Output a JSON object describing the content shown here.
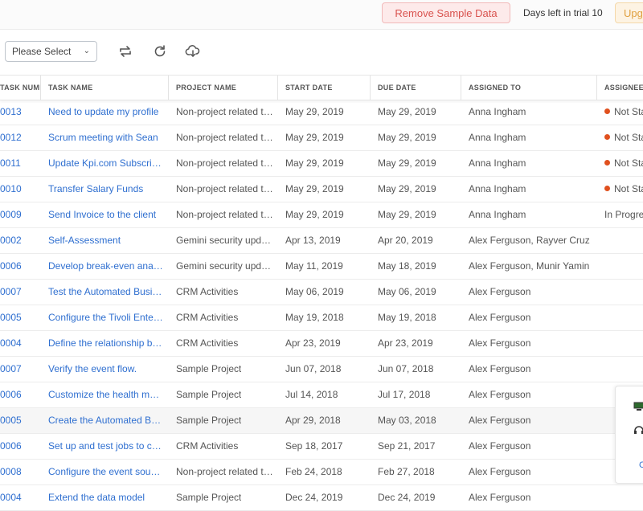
{
  "header": {
    "remove_sample_label": "Remove Sample Data",
    "trial_text": "Days left in trial 10",
    "upgrade_label": "Upgrade"
  },
  "toolbar": {
    "select_value": "Please Select",
    "icons": [
      "swap-icon",
      "refresh-icon",
      "cloud-download-icon"
    ]
  },
  "table": {
    "columns": [
      "TASK NUMBER",
      "TASK NAME",
      "PROJECT NAME",
      "START DATE",
      "DUE DATE",
      "ASSIGNED TO",
      "ASSIGNEE STATUS"
    ],
    "rows": [
      {
        "num": "0013",
        "task": "Need to update my profile",
        "project": "Non-project related tasks",
        "start": "May 29, 2019",
        "due": "May 29, 2019",
        "assigned": "Anna Ingham",
        "status": "Not Started",
        "dot": true
      },
      {
        "num": "0012",
        "task": "Scrum meeting with Sean",
        "project": "Non-project related tasks",
        "start": "May 29, 2019",
        "due": "May 29, 2019",
        "assigned": "Anna Ingham",
        "status": "Not Started",
        "dot": true
      },
      {
        "num": "0011",
        "task": "Update Kpi.com Subscription",
        "project": "Non-project related tasks",
        "start": "May 29, 2019",
        "due": "May 29, 2019",
        "assigned": "Anna Ingham",
        "status": "Not Started",
        "dot": true
      },
      {
        "num": "0010",
        "task": "Transfer Salary Funds",
        "project": "Non-project related tasks",
        "start": "May 29, 2019",
        "due": "May 29, 2019",
        "assigned": "Anna Ingham",
        "status": "Not Started",
        "dot": true
      },
      {
        "num": "0009",
        "task": "Send Invoice to the client",
        "project": "Non-project related tasks",
        "start": "May 29, 2019",
        "due": "May 29, 2019",
        "assigned": "Anna Ingham",
        "status": "In Progress",
        "dot": false
      },
      {
        "num": "0002",
        "task": "Self-Assessment",
        "project": "Gemini security update",
        "start": "Apr 13, 2019",
        "due": "Apr 20, 2019",
        "assigned": "Alex Ferguson, Rayver Cruz",
        "status": "",
        "dot": false
      },
      {
        "num": "0006",
        "task": "Develop break-even analysis",
        "project": "Gemini security update",
        "start": "May 11, 2019",
        "due": "May 18, 2019",
        "assigned": "Alex Ferguson, Munir Yamin",
        "status": "",
        "dot": false
      },
      {
        "num": "0007",
        "task": "Test the Automated Business",
        "project": "CRM Activities",
        "start": "May 06, 2019",
        "due": "May 06, 2019",
        "assigned": "Alex Ferguson",
        "status": "",
        "dot": false
      },
      {
        "num": "0005",
        "task": "Configure the Tivoli Enterprise",
        "project": "CRM Activities",
        "start": "May 19, 2018",
        "due": "May 19, 2018",
        "assigned": "Alex Ferguson",
        "status": "",
        "dot": false
      },
      {
        "num": "0004",
        "task": "Define the relationship between",
        "project": "CRM Activities",
        "start": "Apr 23, 2019",
        "due": "Apr 23, 2019",
        "assigned": "Alex Ferguson",
        "status": "",
        "dot": false
      },
      {
        "num": "0007",
        "task": "Verify the event flow.",
        "project": "Sample Project",
        "start": "Jun 07, 2018",
        "due": "Jun 07, 2018",
        "assigned": "Alex Ferguson",
        "status": "",
        "dot": false
      },
      {
        "num": "0006",
        "task": "Customize the health monitoring",
        "project": "Sample Project",
        "start": "Jul 14, 2018",
        "due": "Jul 17, 2018",
        "assigned": "Alex Ferguson",
        "status": "",
        "dot": false
      },
      {
        "num": "0005",
        "task": "Create the Automated Business",
        "project": "Sample Project",
        "start": "Apr 29, 2018",
        "due": "May 03, 2018",
        "assigned": "Alex Ferguson",
        "status": "",
        "dot": false,
        "highlight": true
      },
      {
        "num": "0006",
        "task": "Set up and test jobs to collect",
        "project": "CRM Activities",
        "start": "Sep 18, 2017",
        "due": "Sep 21, 2017",
        "assigned": "Alex Ferguson",
        "status": "",
        "dot": false
      },
      {
        "num": "0008",
        "task": "Configure the event sources",
        "project": "Non-project related tasks",
        "start": "Feb 24, 2018",
        "due": "Feb 27, 2018",
        "assigned": "Alex Ferguson",
        "status": "",
        "dot": false
      },
      {
        "num": "0004",
        "task": "Extend the data model",
        "project": "Sample Project",
        "start": "Dec 24, 2019",
        "due": "Dec 24, 2019",
        "assigned": "Alex Ferguson",
        "status": "",
        "dot": false
      }
    ]
  },
  "widget": {
    "link_label": "C"
  }
}
